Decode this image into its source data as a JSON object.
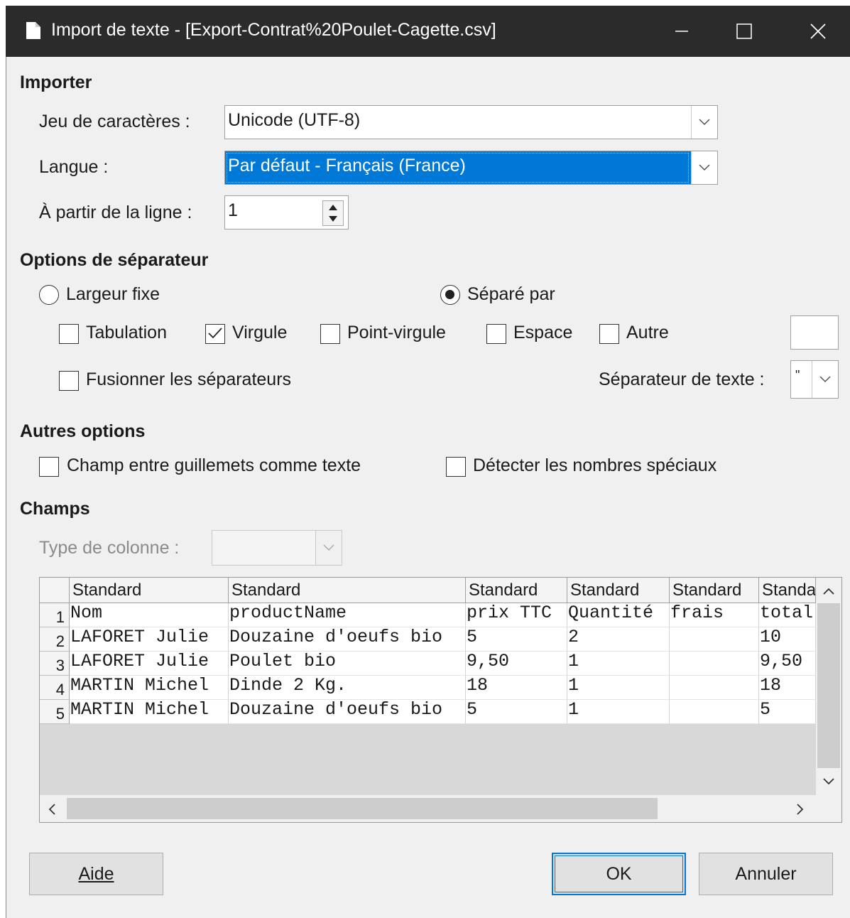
{
  "window": {
    "title": "Import de texte - [Export-Contrat%20Poulet-Cagette.csv]"
  },
  "import": {
    "heading": "Importer",
    "charset_label": "Jeu de caractères :",
    "charset_value": "Unicode (UTF-8)",
    "language_label": "Langue :",
    "language_value": "Par défaut - Français (France)",
    "from_row_label": "À partir de la ligne :",
    "from_row_value": "1"
  },
  "separator": {
    "heading": "Options de séparateur",
    "fixed_width": {
      "label": "Largeur fixe",
      "selected": false
    },
    "separated_by": {
      "label": "Séparé par",
      "selected": true
    },
    "tab": {
      "label": "Tabulation",
      "checked": false
    },
    "comma": {
      "label": "Virgule",
      "checked": true
    },
    "semicolon": {
      "label": "Point-virgule",
      "checked": false
    },
    "space": {
      "label": "Espace",
      "checked": false
    },
    "other": {
      "label": "Autre",
      "checked": false,
      "value": ""
    },
    "merge": {
      "label": "Fusionner les séparateurs",
      "checked": false
    },
    "text_delim_label": "Séparateur de texte :",
    "text_delim_value": "\""
  },
  "other_options": {
    "heading": "Autres options",
    "quoted_as_text": {
      "label": "Champ entre guillemets comme texte",
      "checked": false
    },
    "detect_special": {
      "label": "Détecter les nombres spéciaux",
      "checked": false
    }
  },
  "fields": {
    "heading": "Champs",
    "column_type_label": "Type de colonne :",
    "column_type_value": "",
    "column_headers": [
      "Standard",
      "Standard",
      "Standard",
      "Standard",
      "Standard",
      "Standa"
    ],
    "rows": [
      {
        "num": "1",
        "cells": [
          "Nom",
          "productName",
          "prix TTC",
          "Quantité",
          "frais",
          "total"
        ]
      },
      {
        "num": "2",
        "cells": [
          "LAFORET Julie",
          "Douzaine d'oeufs bio",
          "5",
          "2",
          "",
          "10"
        ]
      },
      {
        "num": "3",
        "cells": [
          "LAFORET Julie",
          "Poulet bio",
          "9,50",
          "1",
          "",
          "9,50"
        ]
      },
      {
        "num": "4",
        "cells": [
          "MARTIN Michel",
          "Dinde 2 Kg.",
          "18",
          "1",
          "",
          "18"
        ]
      },
      {
        "num": "5",
        "cells": [
          "MARTIN Michel",
          "Douzaine d'oeufs bio",
          "5",
          "1",
          "",
          "5"
        ]
      }
    ]
  },
  "buttons": {
    "help": "Aide",
    "ok": "OK",
    "cancel": "Annuler"
  }
}
